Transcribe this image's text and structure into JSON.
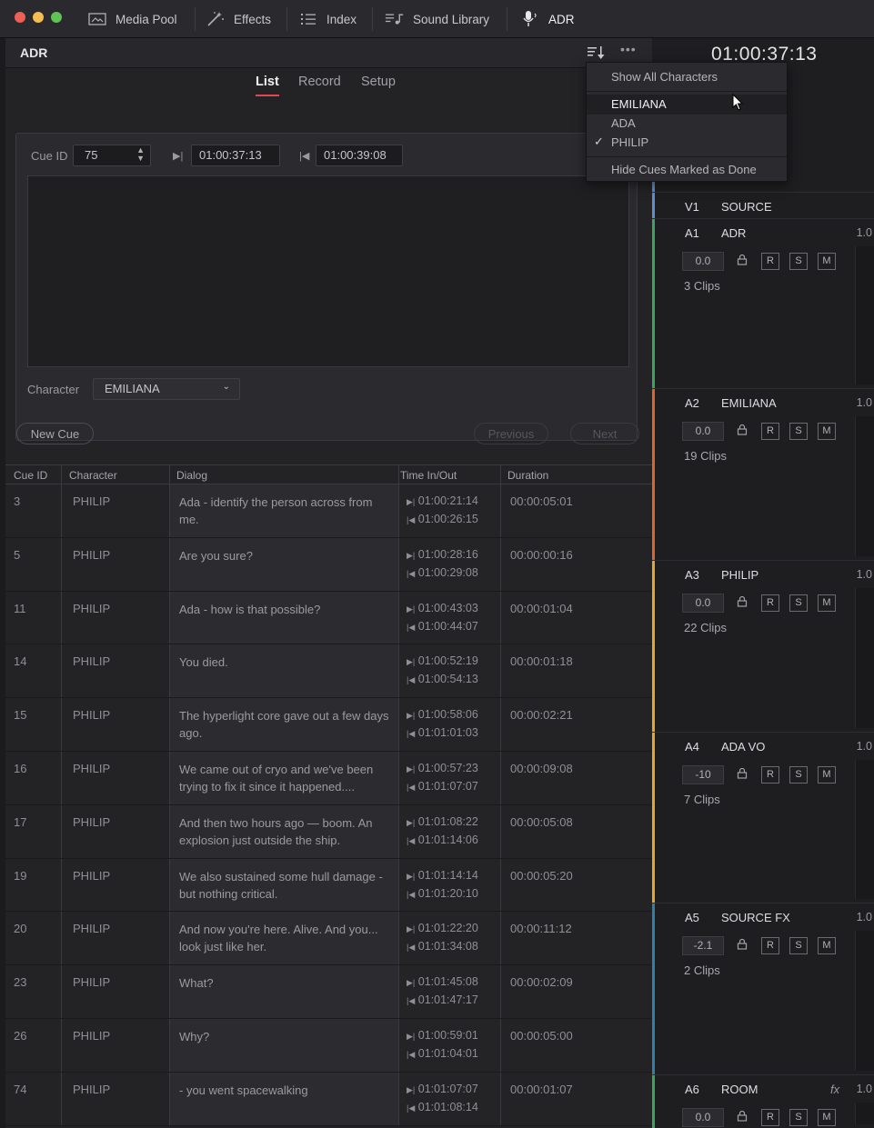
{
  "toolbar": {
    "items": [
      {
        "label": "Media Pool",
        "icon": "media-pool-icon"
      },
      {
        "label": "Effects",
        "icon": "effects-wand-icon"
      },
      {
        "label": "Index",
        "icon": "index-list-icon"
      },
      {
        "label": "Sound Library",
        "icon": "sound-library-icon"
      },
      {
        "label": "ADR",
        "icon": "microphone-icon"
      }
    ]
  },
  "panel": {
    "title": "ADR",
    "tabs": [
      "List",
      "Record",
      "Setup"
    ],
    "active_tab": "List"
  },
  "editor": {
    "cue_id_label": "Cue ID",
    "cue_id_value": "75",
    "time_in": "01:00:37:13",
    "time_out": "01:00:39:08",
    "character_label": "Character",
    "character_value": "EMILIANA"
  },
  "buttons": {
    "new_cue": "New Cue",
    "previous": "Previous",
    "next": "Next"
  },
  "table": {
    "headers": [
      "Cue ID",
      "Character",
      "Dialog",
      "Time In/Out",
      "Duration"
    ],
    "rows": [
      {
        "id": "3",
        "character": "PHILIP",
        "dialog": "Ada - identify the person across from me.",
        "in": "01:00:21:14",
        "out": "01:00:26:15",
        "duration": "00:00:05:01"
      },
      {
        "id": "5",
        "character": "PHILIP",
        "dialog": "Are you sure?",
        "in": "01:00:28:16",
        "out": "01:00:29:08",
        "duration": "00:00:00:16"
      },
      {
        "id": "11",
        "character": "PHILIP",
        "dialog": "Ada - how is that possible?",
        "in": "01:00:43:03",
        "out": "01:00:44:07",
        "duration": "00:00:01:04"
      },
      {
        "id": "14",
        "character": "PHILIP",
        "dialog": "You died.",
        "in": "01:00:52:19",
        "out": "01:00:54:13",
        "duration": "00:00:01:18"
      },
      {
        "id": "15",
        "character": "PHILIP",
        "dialog": "The hyperlight core gave out a few days ago.",
        "in": "01:00:58:06",
        "out": "01:01:01:03",
        "duration": "00:00:02:21"
      },
      {
        "id": "16",
        "character": "PHILIP",
        "dialog": "We came out of cryo and we've been trying to fix it since it happened....",
        "in": "01:00:57:23",
        "out": "01:01:07:07",
        "duration": "00:00:09:08"
      },
      {
        "id": "17",
        "character": "PHILIP",
        "dialog": "And then two hours ago — boom. An explosion just outside the ship.",
        "in": "01:01:08:22",
        "out": "01:01:14:06",
        "duration": "00:00:05:08"
      },
      {
        "id": "19",
        "character": "PHILIP",
        "dialog": "We also sustained some hull damage - but nothing critical.",
        "in": "01:01:14:14",
        "out": "01:01:20:10",
        "duration": "00:00:05:20"
      },
      {
        "id": "20",
        "character": "PHILIP",
        "dialog": "And now you're here. Alive. And you... look just like her.",
        "in": "01:01:22:20",
        "out": "01:01:34:08",
        "duration": "00:00:11:12"
      },
      {
        "id": "23",
        "character": "PHILIP",
        "dialog": "What?",
        "in": "01:01:45:08",
        "out": "01:01:47:17",
        "duration": "00:00:02:09"
      },
      {
        "id": "26",
        "character": "PHILIP",
        "dialog": "Why?",
        "in": "01:00:59:01",
        "out": "01:01:04:01",
        "duration": "00:00:05:00"
      },
      {
        "id": "74",
        "character": "PHILIP",
        "dialog": "- you went spacewalking",
        "in": "01:01:07:07",
        "out": "01:01:08:14",
        "duration": "00:00:01:07"
      }
    ]
  },
  "timecode": "01:00:37:13",
  "tracks": [
    {
      "id": "V1",
      "name": "SOURCE",
      "color": "#5b8fd0"
    },
    {
      "id": "A1",
      "name": "ADR",
      "vol": "1.0",
      "value": "0.0",
      "clips": "3 Clips",
      "color": "#3aa55c"
    },
    {
      "id": "A2",
      "name": "EMILIANA",
      "vol": "1.0",
      "value": "0.0",
      "clips": "19 Clips",
      "color": "#e0642a"
    },
    {
      "id": "A3",
      "name": "PHILIP",
      "vol": "1.0",
      "value": "0.0",
      "clips": "22 Clips",
      "color": "#e2a72e"
    },
    {
      "id": "A4",
      "name": "ADA VO",
      "vol": "1.0",
      "value": "-10",
      "clips": "7 Clips",
      "color": "#e2a72e"
    },
    {
      "id": "A5",
      "name": "SOURCE FX",
      "vol": "1.0",
      "value": "-2.1",
      "clips": "2 Clips",
      "color": "#2f80a8"
    },
    {
      "id": "A6",
      "name": "ROOM",
      "vol": "1.0",
      "value": "0.0",
      "fx": "fx",
      "color": "#3aa55c"
    }
  ],
  "rsm_labels": [
    "R",
    "S",
    "M"
  ],
  "menu": {
    "show_all": "Show All Characters",
    "characters": [
      "EMILIANA",
      "ADA",
      "PHILIP"
    ],
    "checked": "PHILIP",
    "hide_done": "Hide Cues Marked as Done"
  }
}
